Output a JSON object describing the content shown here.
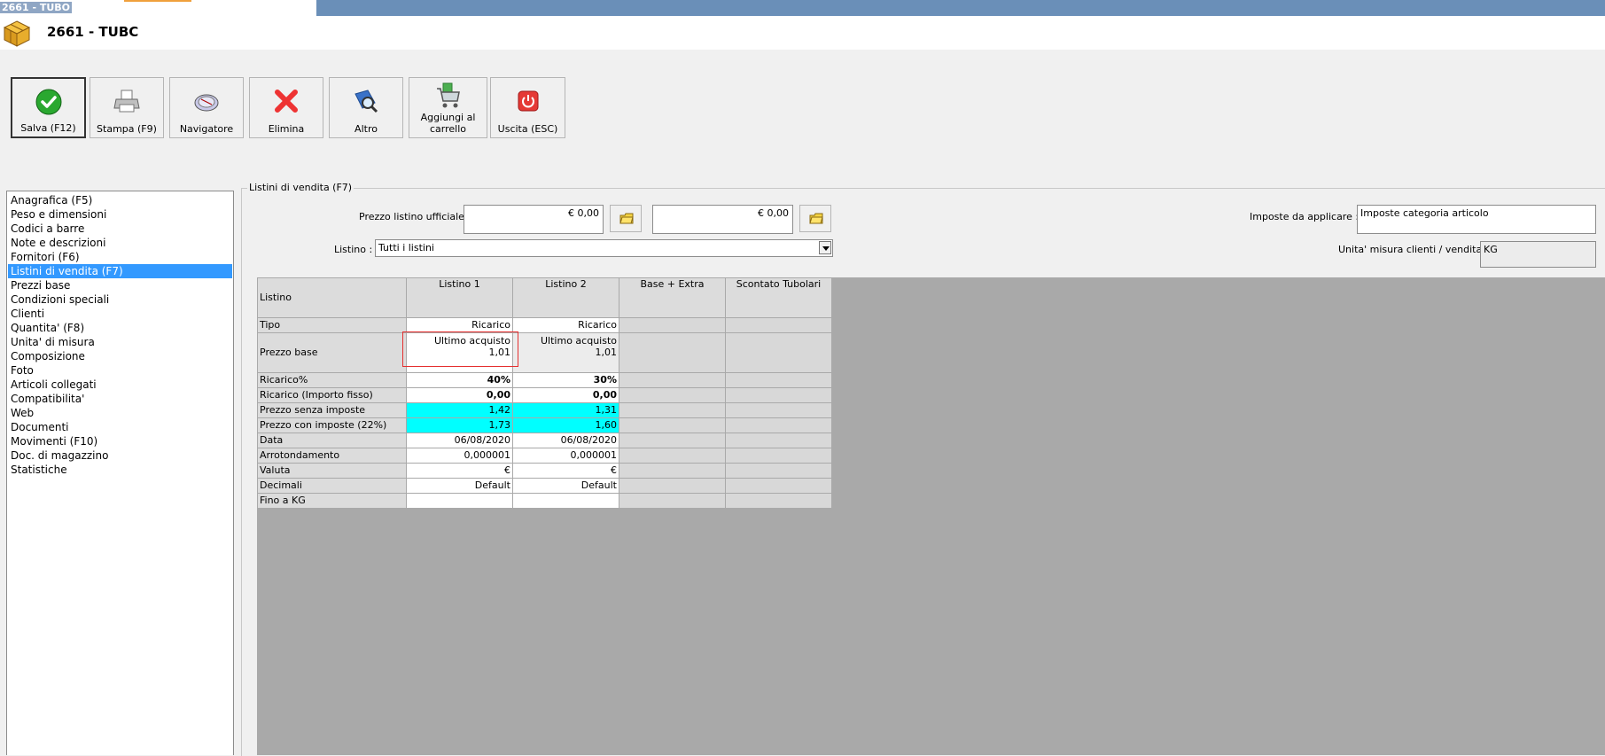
{
  "window": {
    "title_bar": "2661 - TUBO",
    "header_title": "2661 - TUBC"
  },
  "toolbar": [
    {
      "label": "Salva (F12)",
      "icon": "check-icon"
    },
    {
      "label": "Stampa (F9)",
      "icon": "printer-icon"
    },
    {
      "label": "Navigatore",
      "icon": "compass-icon"
    },
    {
      "label": "Elimina",
      "icon": "delete-x-icon"
    },
    {
      "label": "Altro",
      "icon": "search-book-icon"
    },
    {
      "label": "Aggiungi al carrello",
      "icon": "cart-icon"
    },
    {
      "label": "Uscita (ESC)",
      "icon": "power-icon"
    }
  ],
  "sidebar": {
    "items": [
      "Anagrafica (F5)",
      "Peso e dimensioni",
      "Codici a barre",
      "Note e descrizioni",
      "Fornitori (F6)",
      "Listini di vendita (F7)",
      "Prezzi base",
      "Condizioni speciali",
      "Clienti",
      "Quantita' (F8)",
      "Unita' di misura",
      "Composizione",
      "Foto",
      "Articoli collegati",
      "Compatibilita'",
      "Web",
      "Documenti",
      "Movimenti (F10)",
      "Doc. di magazzino",
      "Statistiche"
    ],
    "selected_index": 5
  },
  "panel": {
    "title": "Listini di vendita (F7)",
    "prezzo_label": "Prezzo listino ufficiale :",
    "prezzo_value_1": "€ 0,00",
    "prezzo_value_2": "€ 0,00",
    "listino_label": "Listino :",
    "listino_value": "Tutti i listini",
    "imposte_label": "Imposte da applicare :",
    "imposte_value": "Imposte categoria articolo",
    "unita_label": "Unita' misura clienti / vendita :",
    "unita_value": "KG"
  },
  "grid": {
    "columns": [
      "Listino",
      "Listino 1",
      "Listino 2",
      "Base + Extra",
      "Scontato Tubolari"
    ],
    "rows": {
      "tipo": {
        "label": "Tipo",
        "values": [
          "Ricarico",
          "Ricarico"
        ]
      },
      "prezzo_base": {
        "label": "Prezzo base",
        "source": [
          "Ultimo acquisto",
          "Ultimo acquisto"
        ],
        "values": [
          "1,01",
          "1,01"
        ]
      },
      "ricarico_pct": {
        "label": "Ricarico%",
        "values": [
          "40%",
          "30%"
        ]
      },
      "ricarico_fisso": {
        "label": "Ricarico (Importo fisso)",
        "values": [
          "0,00",
          "0,00"
        ]
      },
      "senza_imposte": {
        "label": "Prezzo senza imposte",
        "values": [
          "1,42",
          "1,31"
        ]
      },
      "con_imposte": {
        "label": "Prezzo con imposte (22%)",
        "values": [
          "1,73",
          "1,60"
        ]
      },
      "data": {
        "label": "Data",
        "values": [
          "06/08/2020",
          "06/08/2020"
        ]
      },
      "arrotondamento": {
        "label": "Arrotondamento",
        "values": [
          "0,000001",
          "0,000001"
        ]
      },
      "valuta": {
        "label": "Valuta",
        "values": [
          "€",
          "€"
        ]
      },
      "decimali": {
        "label": "Decimali",
        "values": [
          "Default",
          "Default"
        ]
      },
      "fino_a": {
        "label": "Fino a KG",
        "values": [
          "",
          ""
        ]
      }
    }
  },
  "colors": {
    "selection": "#3399ff",
    "highlight_cyan": "#00ffff",
    "grid_bg": "#a9a9a9",
    "titlebar": "#6a8fb8"
  }
}
